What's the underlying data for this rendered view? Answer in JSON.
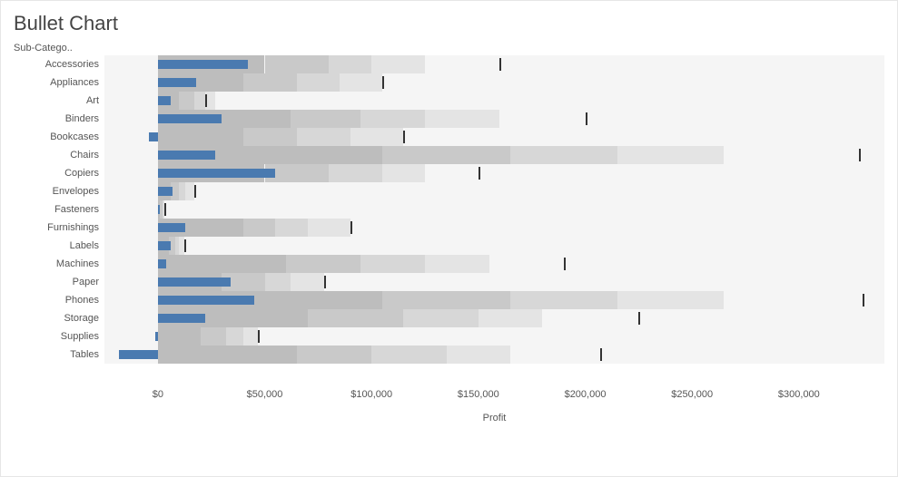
{
  "title": "Bullet Chart",
  "sub_header": "Sub-Catego..",
  "xlabel": "Profit",
  "colors": {
    "bar": "#4a7ab0",
    "band_bg": "#f5f5f5",
    "band_shades": [
      "#bdbdbd",
      "#c9c9c9",
      "#d7d7d7",
      "#e4e4e4"
    ],
    "mark": "#333333"
  },
  "chart_data": {
    "type": "bar",
    "axis": {
      "min": -25000,
      "max": 340000
    },
    "ticks": [
      0,
      50000,
      100000,
      150000,
      200000,
      250000,
      300000
    ],
    "tick_labels": [
      "$0",
      "$50,000",
      "$100,000",
      "$150,000",
      "$200,000",
      "$250,000",
      "$300,000"
    ],
    "series": [
      {
        "name": "Accessories",
        "value": 42000,
        "bands": [
          50000,
          80000,
          100000,
          125000
        ],
        "target": 160000
      },
      {
        "name": "Appliances",
        "value": 18000,
        "bands": [
          40000,
          65000,
          85000,
          105000
        ],
        "target": 105000
      },
      {
        "name": "Art",
        "value": 6000,
        "bands": [
          10000,
          17000,
          22000,
          27000
        ],
        "target": 22000
      },
      {
        "name": "Binders",
        "value": 30000,
        "bands": [
          62000,
          95000,
          125000,
          160000
        ],
        "target": 200000
      },
      {
        "name": "Bookcases",
        "value": -4000,
        "bands": [
          40000,
          65000,
          90000,
          115000
        ],
        "target": 115000
      },
      {
        "name": "Chairs",
        "value": 27000,
        "bands": [
          105000,
          165000,
          215000,
          265000
        ],
        "target": 328000
      },
      {
        "name": "Copiers",
        "value": 55000,
        "bands": [
          50000,
          80000,
          105000,
          125000
        ],
        "target": 150000
      },
      {
        "name": "Envelopes",
        "value": 7000,
        "bands": [
          6000,
          10000,
          13000,
          17000
        ],
        "target": 17000
      },
      {
        "name": "Fasteners",
        "value": 1000,
        "bands": [
          1000,
          2000,
          2500,
          3000
        ],
        "target": 3000
      },
      {
        "name": "Furnishings",
        "value": 13000,
        "bands": [
          40000,
          55000,
          70000,
          90000
        ],
        "target": 90000
      },
      {
        "name": "Labels",
        "value": 6000,
        "bands": [
          5000,
          8000,
          10000,
          12500
        ],
        "target": 12500
      },
      {
        "name": "Machines",
        "value": 4000,
        "bands": [
          60000,
          95000,
          125000,
          155000
        ],
        "target": 190000
      },
      {
        "name": "Paper",
        "value": 34000,
        "bands": [
          30000,
          50000,
          62000,
          78000
        ],
        "target": 78000
      },
      {
        "name": "Phones",
        "value": 45000,
        "bands": [
          105000,
          165000,
          215000,
          265000
        ],
        "target": 330000
      },
      {
        "name": "Storage",
        "value": 22000,
        "bands": [
          70000,
          115000,
          150000,
          180000
        ],
        "target": 225000
      },
      {
        "name": "Supplies",
        "value": -1000,
        "bands": [
          20000,
          32000,
          40000,
          47000
        ],
        "target": 47000
      },
      {
        "name": "Tables",
        "value": -18000,
        "bands": [
          65000,
          100000,
          135000,
          165000
        ],
        "target": 207000
      }
    ]
  }
}
